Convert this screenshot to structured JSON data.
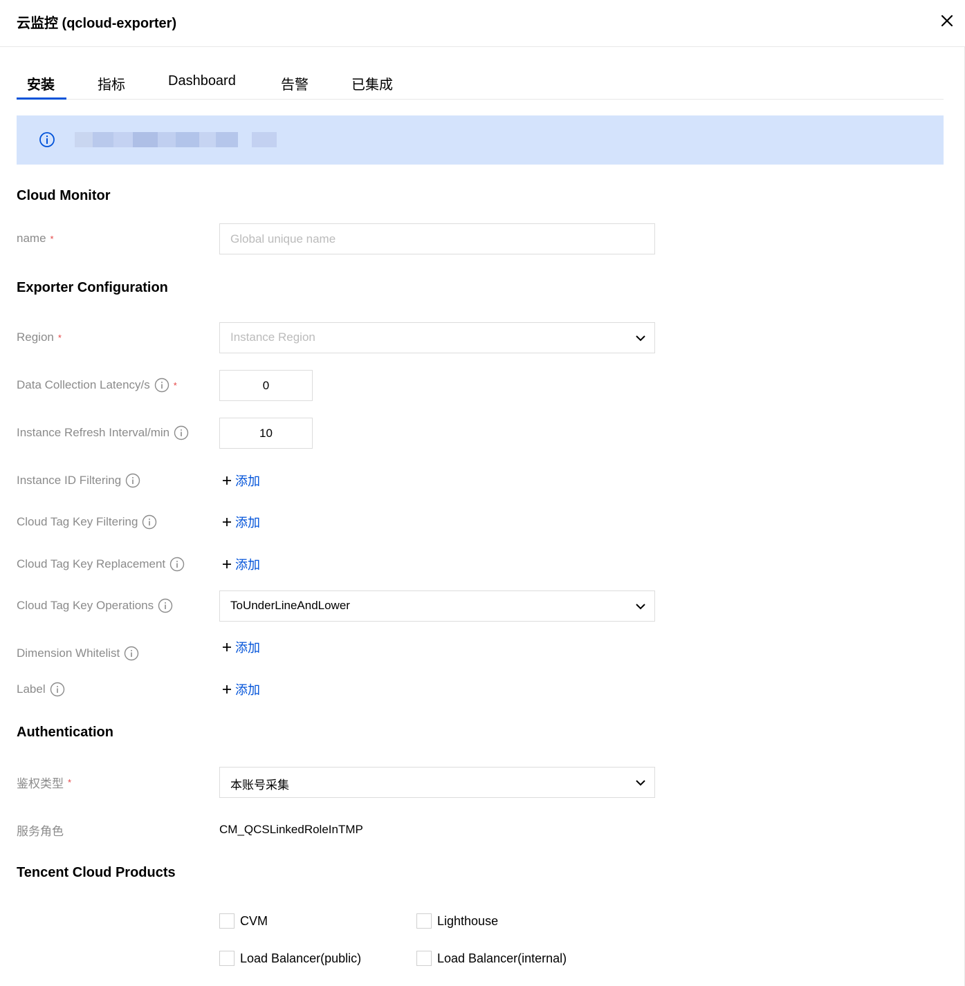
{
  "dialog": {
    "title": "云监控 (qcloud-exporter)"
  },
  "tabs": [
    {
      "label": "安装"
    },
    {
      "label": "指标"
    },
    {
      "label": "Dashboard"
    },
    {
      "label": "告警"
    },
    {
      "label": "已集成"
    }
  ],
  "sections": {
    "cloud_monitor": "Cloud Monitor",
    "exporter_configuration": "Exporter Configuration",
    "authentication": "Authentication",
    "products": "Tencent Cloud Products"
  },
  "form": {
    "name": {
      "label": "name",
      "placeholder": "Global unique name",
      "value": ""
    },
    "region": {
      "label": "Region",
      "placeholder": "Instance Region"
    },
    "latency": {
      "label": "Data Collection Latency/s",
      "value": "0"
    },
    "refresh": {
      "label": "Instance Refresh Interval/min",
      "value": "10"
    },
    "instance_id_filtering": {
      "label": "Instance ID Filtering"
    },
    "tag_key_filtering": {
      "label": "Cloud Tag Key Filtering"
    },
    "tag_key_replacement": {
      "label": "Cloud Tag Key Replacement"
    },
    "tag_key_operations": {
      "label": "Cloud Tag Key Operations",
      "value": "ToUnderLineAndLower"
    },
    "dimension_whitelist": {
      "label": "Dimension Whitelist"
    },
    "label": {
      "label": "Label"
    },
    "auth_type": {
      "label": "鉴权类型",
      "value": "本账号采集"
    },
    "service_role": {
      "label": "服务角色",
      "value": "CM_QCSLinkedRoleInTMP"
    }
  },
  "add_label": "添加",
  "required_mark": "*",
  "products": [
    {
      "label": "CVM"
    },
    {
      "label": "Lighthouse"
    },
    {
      "label": "Load Balancer(public)"
    },
    {
      "label": "Load Balancer(internal)"
    }
  ],
  "colors": {
    "accent": "#0052d9",
    "notice_bg": "#d4e3fc",
    "required": "#e54545",
    "label_text": "#8b8b8b"
  }
}
